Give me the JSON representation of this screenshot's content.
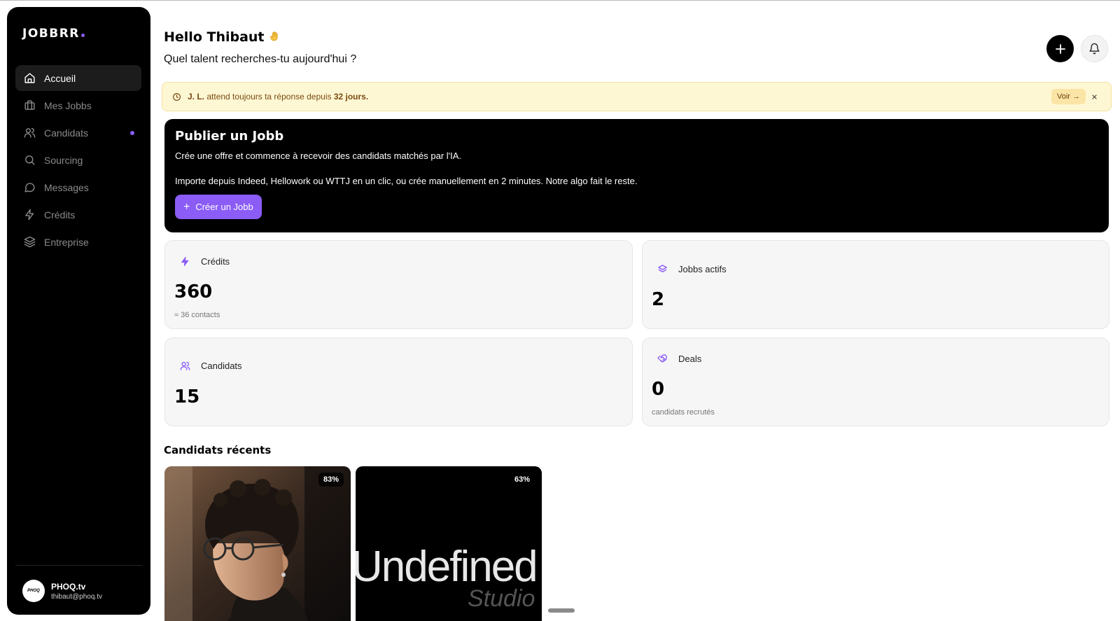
{
  "sidebar": {
    "logo": "JOBBRR",
    "items": [
      {
        "label": "Accueil",
        "icon": "home-icon",
        "active": true
      },
      {
        "label": "Mes Jobbs",
        "icon": "briefcase-icon"
      },
      {
        "label": "Candidats",
        "icon": "users-icon",
        "notification": true
      },
      {
        "label": "Sourcing",
        "icon": "search-icon"
      },
      {
        "label": "Messages",
        "icon": "message-icon"
      },
      {
        "label": "Crédits",
        "icon": "bolt-icon"
      },
      {
        "label": "Entreprise",
        "icon": "layers-icon"
      }
    ],
    "account": {
      "avatar": "PHOQ",
      "name": "PHOQ.tv",
      "email": "thibaut@phoq.tv"
    }
  },
  "header": {
    "greeting": "Hello Thibaut",
    "subtitle": "Quel talent recherches-tu aujourd'hui ?"
  },
  "alert": {
    "name": "J. L.",
    "text": "attend toujours ta réponse depuis",
    "days": "32 jours.",
    "action": "Voir →"
  },
  "hero": {
    "title": "Publier un Jobb",
    "line1": "Crée une offre et commence à recevoir des candidats matchés par l'IA.",
    "line2": "Importe depuis Indeed, Hellowork ou WTTJ en un clic, ou crée manuellement en 2 minutes. Notre algo fait le reste.",
    "button": "Créer un Jobb",
    "button_icon": "+"
  },
  "stats": {
    "credits": {
      "label": "Crédits",
      "value": "360",
      "sub": "≈ 36 contacts"
    },
    "jobbs": {
      "label": "Jobbs actifs",
      "value": "2"
    },
    "candidats": {
      "label": "Candidats",
      "value": "15"
    },
    "deals": {
      "label": "Deals",
      "value": "0",
      "sub": "candidats recrutés"
    }
  },
  "recent": {
    "title": "Candidats récents",
    "candidates": [
      {
        "match": "83%"
      },
      {
        "match": "63%",
        "image_text": "Undefined",
        "image_subtext": "Studio"
      }
    ]
  },
  "colors": {
    "accent": "#8b5cf6",
    "alert_bg": "#fef7d3",
    "sidebar_bg": "#000000"
  }
}
